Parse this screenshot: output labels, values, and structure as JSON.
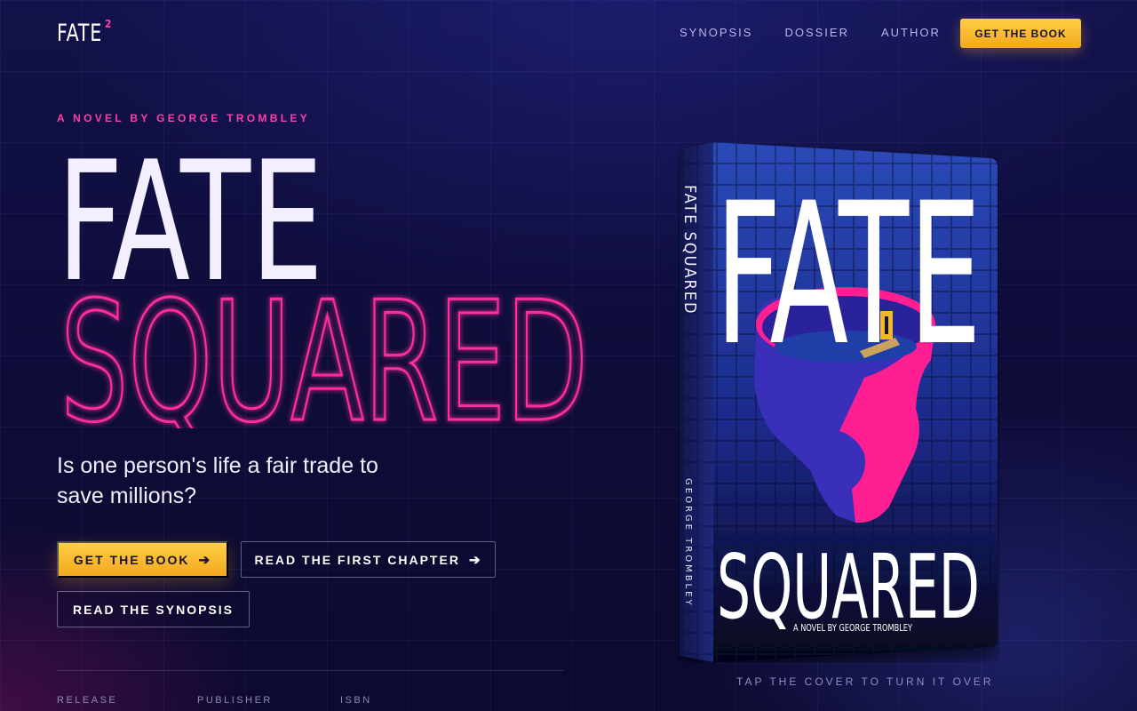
{
  "nav": {
    "logo": "FATE",
    "logo_sup": "2",
    "links": [
      "SYNOPSIS",
      "DOSSIER",
      "AUTHOR"
    ],
    "cta": "GET THE BOOK"
  },
  "hero": {
    "kicker": "A NOVEL BY GEORGE TROMBLEY",
    "title_line1": "FATE",
    "title_line2": "SQUARED",
    "tagline": "Is one person's life a fair trade to save millions?",
    "buttons": {
      "get_book": "GET THE BOOK",
      "first_chapter": "READ THE FIRST CHAPTER",
      "synopsis": "READ THE SYNOPSIS"
    },
    "meta_labels": [
      "RELEASE",
      "PUBLISHER",
      "ISBN"
    ]
  },
  "book": {
    "cover_title_top": "FATE",
    "cover_title_bottom": "SQUARED",
    "cover_byline": "A NOVEL BY GEORGE TROMBLEY",
    "spine_title": "FATE SQUARED",
    "spine_author": "GEORGE TROMBLEY",
    "caption": "TAP THE COVER TO TURN IT OVER"
  },
  "colors": {
    "accent_pink": "#ff3fa6",
    "accent_gold": "#f7b52c",
    "background": "#0f0d3c"
  },
  "icons": [
    "arrow-right-icon"
  ]
}
